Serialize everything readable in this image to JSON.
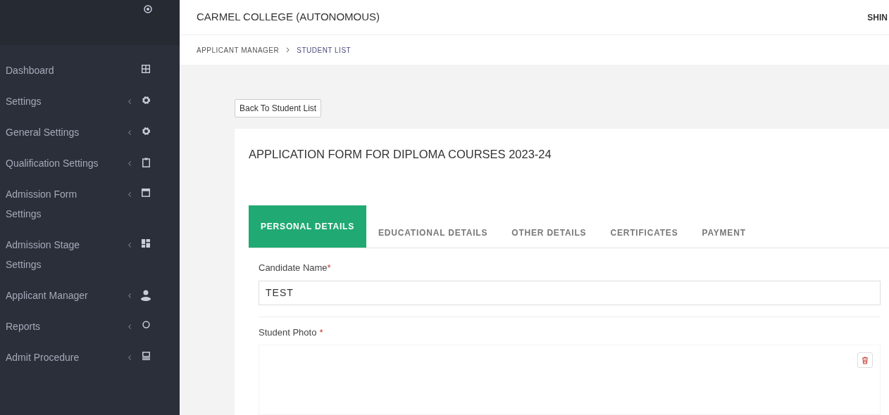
{
  "sidebar": {
    "items": [
      {
        "label": "Dashboard",
        "has_submenu": false
      },
      {
        "label": "Settings",
        "has_submenu": true
      },
      {
        "label": "General Settings",
        "has_submenu": true
      },
      {
        "label": "Qualification Settings",
        "has_submenu": true
      },
      {
        "label": "Admission Form Settings",
        "has_submenu": true
      },
      {
        "label": "Admission Stage Settings",
        "has_submenu": true
      },
      {
        "label": "Applicant Manager",
        "has_submenu": true
      },
      {
        "label": "Reports",
        "has_submenu": true
      },
      {
        "label": "Admit Procedure",
        "has_submenu": true
      }
    ]
  },
  "header": {
    "title": "CARMEL COLLEGE (AUTONOMOUS)",
    "user": "SHIN"
  },
  "breadcrumb": [
    {
      "label": "APPLICANT MANAGER",
      "current": false
    },
    {
      "label": "STUDENT LIST",
      "current": true
    }
  ],
  "back_button": "Back To Student List",
  "form": {
    "title": "APPLICATION FORM FOR DIPLOMA COURSES 2023-24",
    "tabs": [
      {
        "label": "PERSONAL DETAILS",
        "selected": true
      },
      {
        "label": "EDUCATIONAL DETAILS",
        "selected": false
      },
      {
        "label": "OTHER DETAILS",
        "selected": false
      },
      {
        "label": "CERTIFICATES",
        "selected": false
      },
      {
        "label": "PAYMENT",
        "selected": false
      }
    ],
    "candidate_name": {
      "label": "Candidate Name",
      "required_mark": "*",
      "value": "TEST"
    },
    "student_photo": {
      "label": "Student Photo",
      "required_mark": "*"
    }
  }
}
